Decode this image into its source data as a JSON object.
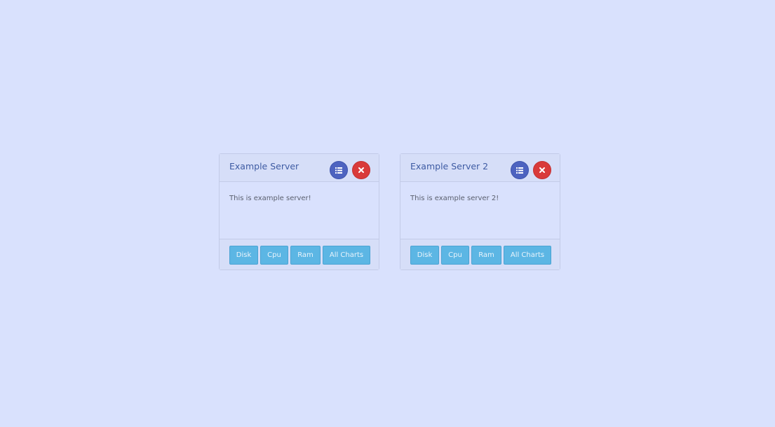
{
  "colors": {
    "background": "#d9e1fd",
    "title": "#3e5ba3",
    "list_button": "#4d63c0",
    "close_button": "#d93a3a",
    "action_button": "#5cb6e4"
  },
  "servers": [
    {
      "title": "Example Server",
      "description": "This is example server!",
      "icons": {
        "list": "list-icon",
        "close": "close-icon"
      },
      "buttons": {
        "disk": "Disk",
        "cpu": "Cpu",
        "ram": "Ram",
        "all": "All Charts"
      }
    },
    {
      "title": "Example Server 2",
      "description": "This is example server 2!",
      "icons": {
        "list": "list-icon",
        "close": "close-icon"
      },
      "buttons": {
        "disk": "Disk",
        "cpu": "Cpu",
        "ram": "Ram",
        "all": "All Charts"
      }
    }
  ]
}
